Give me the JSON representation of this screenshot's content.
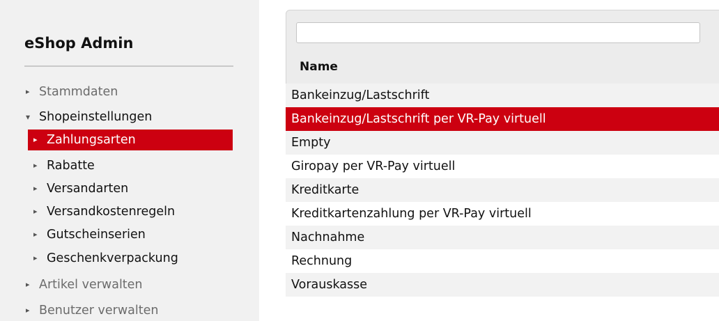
{
  "sidebar": {
    "title": "eShop Admin",
    "items": [
      {
        "label": "Stammdaten",
        "arrow": "▸"
      },
      {
        "label": "Shopeinstellungen",
        "arrow": "▾"
      },
      {
        "label": "Artikel verwalten",
        "arrow": "▸"
      },
      {
        "label": "Benutzer verwalten",
        "arrow": "▸"
      }
    ],
    "subitems": [
      {
        "label": "Zahlungsarten",
        "arrow": "▸"
      },
      {
        "label": "Rabatte",
        "arrow": "▸"
      },
      {
        "label": "Versandarten",
        "arrow": "▸"
      },
      {
        "label": "Versandkostenregeln",
        "arrow": "▸"
      },
      {
        "label": "Gutscheinserien",
        "arrow": "▸"
      },
      {
        "label": "Geschenkverpackung",
        "arrow": "▸"
      }
    ]
  },
  "main": {
    "filter": {
      "value": "",
      "placeholder": ""
    },
    "column_header": "Name",
    "rows": [
      "Bankeinzug/Lastschrift",
      "Bankeinzug/Lastschrift per VR-Pay virtuell",
      "Empty",
      "Giropay per VR-Pay virtuell",
      "Kreditkarte",
      "Kreditkartenzahlung per VR-Pay virtuell",
      "Nachnahme",
      "Rechnung",
      "Vorauskasse"
    ],
    "selected_row": "Bankeinzug/Lastschrift per VR-Pay virtuell"
  },
  "colors": {
    "accent": "#cc0010",
    "sidebar_bg": "#f1f1f1"
  }
}
